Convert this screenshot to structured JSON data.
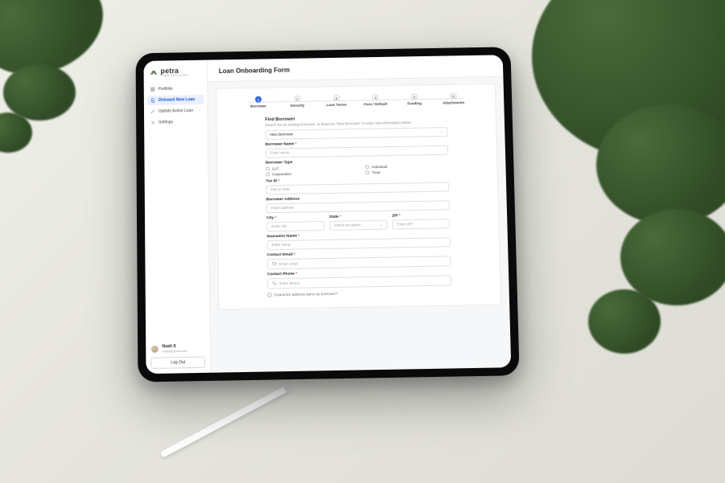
{
  "brand": {
    "name": "petra",
    "tagline": "LOAN SERVICING"
  },
  "sidebar": {
    "items": [
      {
        "label": "Portfolio"
      },
      {
        "label": "Onboard New Loan"
      },
      {
        "label": "Update Active Loan"
      },
      {
        "label": "Settings"
      }
    ]
  },
  "user": {
    "name": "Noah S",
    "email": "noah@gmail.com",
    "logout": "Log Out"
  },
  "page": {
    "title": "Loan Onboarding Form"
  },
  "stepper": [
    {
      "num": "1",
      "label": "Borrower"
    },
    {
      "num": "2",
      "label": "Security"
    },
    {
      "num": "3",
      "label": "Loan Terms"
    },
    {
      "num": "4",
      "label": "Fees / Default"
    },
    {
      "num": "5",
      "label": "Funding"
    },
    {
      "num": "6",
      "label": "Attachments"
    }
  ],
  "form": {
    "find_title": "Find Borrower",
    "find_sub": "Search for an existing borrower, or leave as \"New Borrower\" to enter new information below.",
    "find_value": "New Borrower",
    "borrower_name_label": "Borrower Name",
    "borrower_name_ph": "Enter name",
    "borrower_type_label": "Borrower Type",
    "type_opts": {
      "llc": "LLC",
      "individual": "Individual",
      "corporation": "Corporation",
      "trust": "Trust"
    },
    "taxid_label": "Tax ID",
    "taxid_ph": "EIN or SSN",
    "address_label": "Borrower Address",
    "address_ph": "Enter address",
    "city_label": "City",
    "city_ph": "Enter city",
    "state_label": "State",
    "state_ph": "Select an option",
    "zip_label": "ZIP",
    "zip_ph": "Enter ZIP",
    "guarantor_name_label": "Guarantor Name",
    "guarantor_name_ph": "Enter name",
    "contact_email_label": "Contact Email",
    "contact_email_ph": "Enter email",
    "contact_phone_label": "Contact Phone",
    "contact_phone_ph": "Enter phone",
    "same_address_label": "Guarantor address same as borrower?"
  }
}
